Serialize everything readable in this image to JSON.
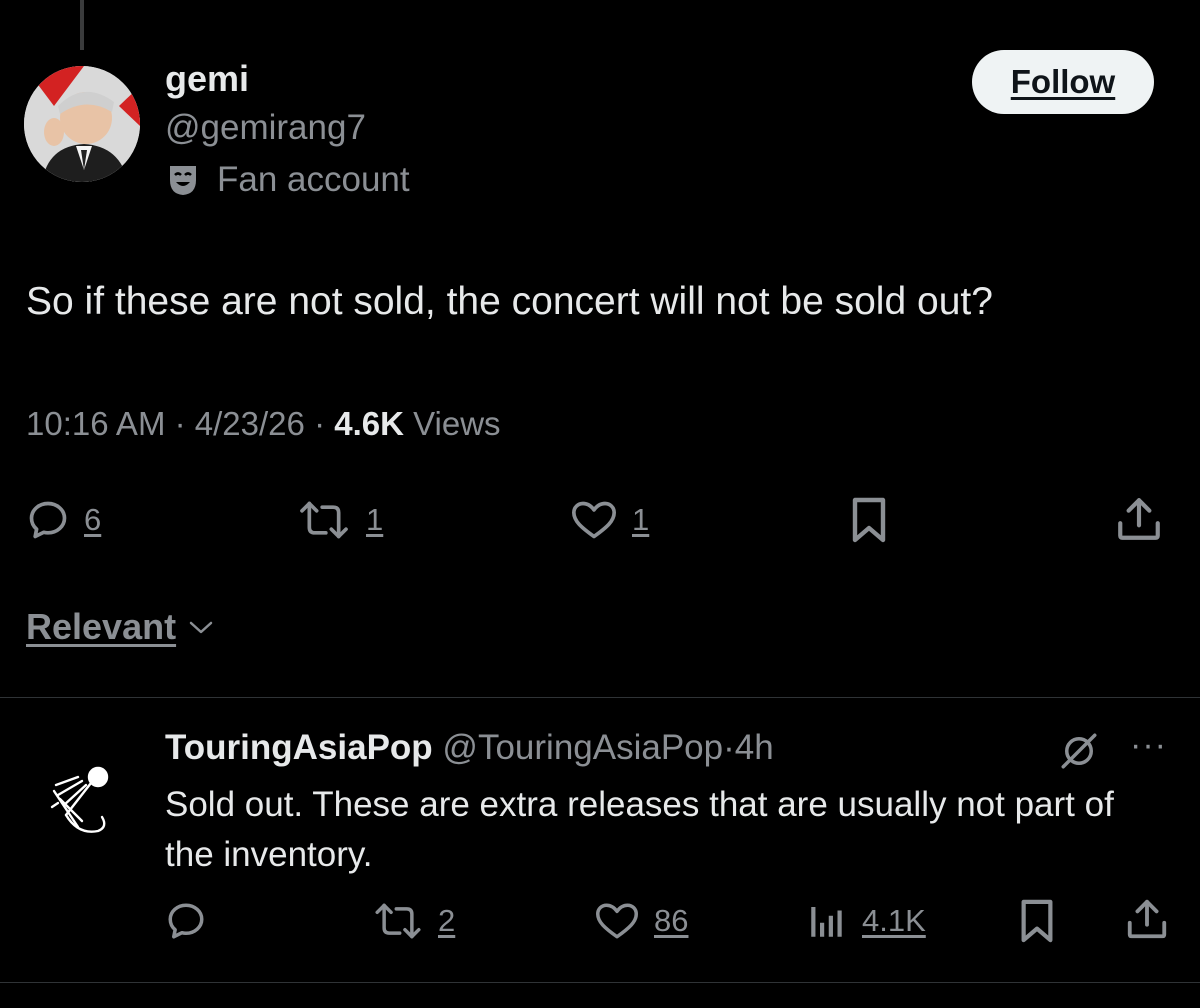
{
  "tweet": {
    "author_name": "gemi",
    "author_handle": "@gemirang7",
    "badge_label": "Fan account",
    "follow_label": "Follow",
    "text": "So if these are not sold, the concert will not be sold out?",
    "time": "10:16 AM",
    "date": "4/23/26",
    "separator": "·",
    "views_count": "4.6K",
    "views_label": "Views",
    "reply_count": "6",
    "retweet_count": "1",
    "like_count": "1"
  },
  "sort": {
    "label": "Relevant"
  },
  "reply": {
    "author_name": "TouringAsiaPop",
    "author_handle": "@TouringAsiaPop",
    "age": "4h",
    "separator": "·",
    "text": "Sold out. These are extra releases that are usually not part of the inventory.",
    "retweet_count": "2",
    "like_count": "86",
    "views_count": "4.1K",
    "more_label": "···"
  },
  "icons": [
    "reply-icon",
    "retweet-icon",
    "like-icon",
    "bookmark-icon",
    "share-icon",
    "views-icon",
    "grok-icon",
    "more-icon",
    "fan-account-icon",
    "chevron-down-icon"
  ],
  "colors": {
    "background": "#000000",
    "text": "#e7e9ea",
    "muted": "#8b8f94",
    "follow_bg": "#eff3f4",
    "divider": "#2f3336"
  }
}
